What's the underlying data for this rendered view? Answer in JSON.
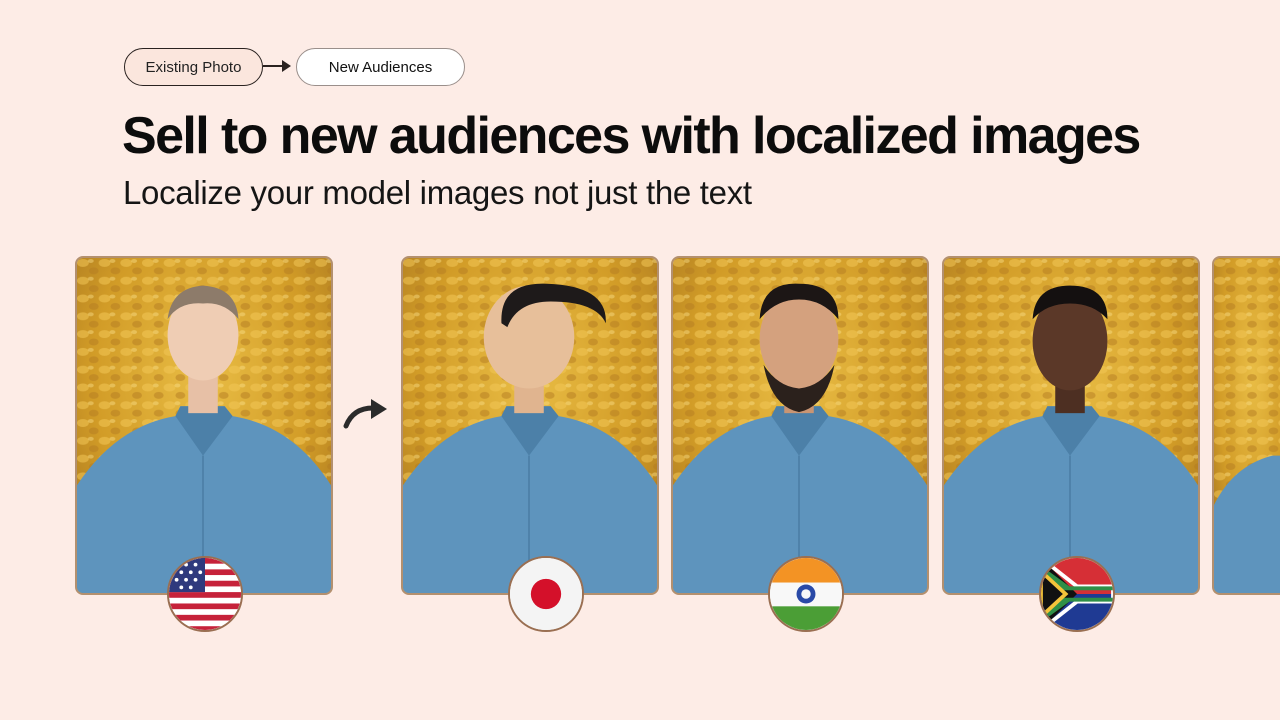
{
  "pills": {
    "existing_label": "Existing Photo",
    "new_label": "New Audiences"
  },
  "hero": {
    "headline": "Sell to new audiences with localized images",
    "subheadline": "Localize your model images not just the text"
  },
  "colors": {
    "background": "#fdece6",
    "card_border": "#b3906f",
    "shirt": "#5e94bd",
    "foliage": "#d8a52c"
  },
  "cards": [
    {
      "id": "original",
      "role": "existing-photo",
      "flag_icon": "usa-flag-icon"
    },
    {
      "id": "japan",
      "role": "localized",
      "flag_icon": "japan-flag-icon"
    },
    {
      "id": "india",
      "role": "localized",
      "flag_icon": "india-flag-icon"
    },
    {
      "id": "south-africa",
      "role": "localized",
      "flag_icon": "south-africa-flag-icon"
    },
    {
      "id": "partial",
      "role": "localized"
    }
  ],
  "icons": {
    "pill_arrow": "arrow-right-icon",
    "transform_arrow": "curved-arrow-icon"
  }
}
